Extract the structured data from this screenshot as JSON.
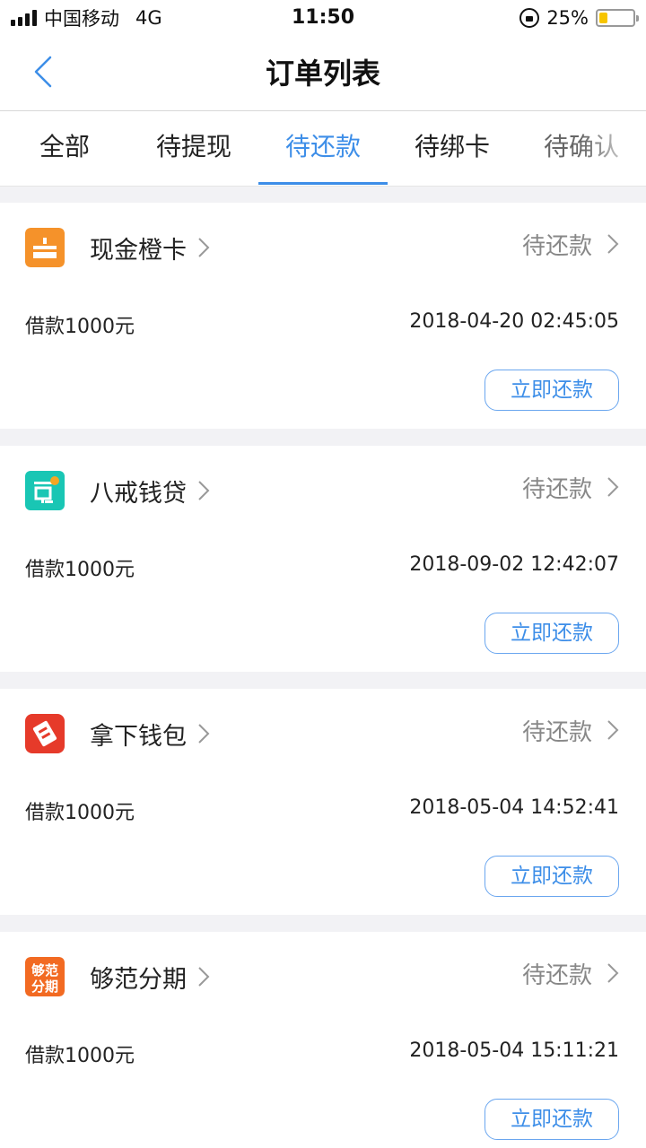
{
  "status_bar": {
    "carrier": "中国移动",
    "network": "4G",
    "time": "11:50",
    "battery": "25%",
    "battery_level": 0.25
  },
  "nav": {
    "title": "订单列表",
    "back_icon": "chevron-left-icon"
  },
  "tabs": [
    {
      "label": "全部",
      "active": false
    },
    {
      "label": "待提现",
      "active": false
    },
    {
      "label": "待还款",
      "active": true
    },
    {
      "label": "待绑卡",
      "active": false
    },
    {
      "label": "待确认",
      "active": false
    }
  ],
  "orders": [
    {
      "logo": "xianjin-chengka-logo",
      "name": "现金橙卡",
      "status": "待还款",
      "amount": "借款1000元",
      "datetime": "2018-04-20 02:45:05",
      "action": "立即还款"
    },
    {
      "logo": "bajie-qiandai-logo",
      "name": "八戒钱贷",
      "status": "待还款",
      "amount": "借款1000元",
      "datetime": "2018-09-02 12:42:07",
      "action": "立即还款"
    },
    {
      "logo": "naxia-qianbao-logo",
      "name": "拿下钱包",
      "status": "待还款",
      "amount": "借款1000元",
      "datetime": "2018-05-04 14:52:41",
      "action": "立即还款"
    },
    {
      "logo": "goufan-fenqi-logo",
      "name": "够范分期",
      "status": "待还款",
      "amount": "借款1000元",
      "datetime": "2018-05-04 15:11:21",
      "action": "立即还款",
      "logo_text_1": "够范",
      "logo_text_2": "分期"
    }
  ],
  "colors": {
    "accent": "#3d8ee8",
    "background": "#f2f2f5",
    "status_gray": "#888888"
  }
}
